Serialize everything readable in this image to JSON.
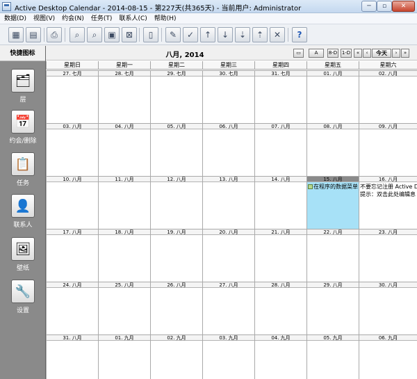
{
  "window": {
    "title": "Active Desktop Calendar - 2014-08-15 - 第227天(共365天) - 当前用户: Administrator",
    "min": "─",
    "max": "▫",
    "close": "✕"
  },
  "menu": [
    "数据(D)",
    "视图(V)",
    "约会(N)",
    "任务(T)",
    "联系人(C)",
    "帮助(H)"
  ],
  "toolbar": {
    "icons": [
      "calendar-icon",
      "calendar-alarm-icon",
      "print-icon",
      "find-icon",
      "find-next-icon",
      "view-icon",
      "delete-view-icon",
      "notes-icon",
      "edit-icon",
      "check-icon",
      "move-up-icon",
      "move-down-icon",
      "move-bottom-icon",
      "move-top-icon",
      "clear-icon",
      "help-icon"
    ],
    "help": "?"
  },
  "sidebar": {
    "header": "快捷图标",
    "items": [
      {
        "label": "层",
        "icon": "layers-icon"
      },
      {
        "label": "约会/删除",
        "icon": "calendar-icon"
      },
      {
        "label": "任务",
        "icon": "task-clipboard-icon"
      },
      {
        "label": "联系人",
        "icon": "contact-icon"
      },
      {
        "label": "壁纸",
        "icon": "wallpaper-icon"
      },
      {
        "label": "设置",
        "icon": "settings-icon"
      }
    ]
  },
  "calendar": {
    "month_title": "八月, 2014",
    "nav": {
      "prev_year": "«",
      "prev": "‹",
      "today": "今天",
      "next": "›",
      "next_year": "»",
      "v1": "A",
      "v2": "8-D",
      "v3": "1-D"
    },
    "weekdays": [
      "星期日",
      "星期一",
      "星期二",
      "星期三",
      "星期四",
      "星期五",
      "星期六"
    ],
    "weeks": [
      [
        "27. 七月",
        "28. 七月",
        "29. 七月",
        "30. 七月",
        "31. 七月",
        "01. 八月",
        "02. 八月"
      ],
      [
        "03. 八月",
        "04. 八月",
        "05. 八月",
        "06. 八月",
        "07. 八月",
        "08. 八月",
        "09. 八月"
      ],
      [
        "10. 八月",
        "11. 八月",
        "12. 八月",
        "13. 八月",
        "14. 八月",
        "15. 八月",
        "16. 八月"
      ],
      [
        "17. 八月",
        "18. 八月",
        "19. 八月",
        "20. 八月",
        "21. 八月",
        "22. 八月",
        "23. 八月"
      ],
      [
        "24. 八月",
        "25. 八月",
        "26. 八月",
        "27. 八月",
        "28. 八月",
        "29. 八月",
        "30. 八月"
      ],
      [
        "31. 八月",
        "01. 九月",
        "02. 九月",
        "03. 九月",
        "04. 九月",
        "05. 九月",
        "06. 九月"
      ]
    ],
    "events": {
      "fri15": "在程序的数据菜单",
      "sat16_line1": "不要忘记注册 Active D",
      "sat16_line2": "提示：双击此处编辑息"
    }
  }
}
